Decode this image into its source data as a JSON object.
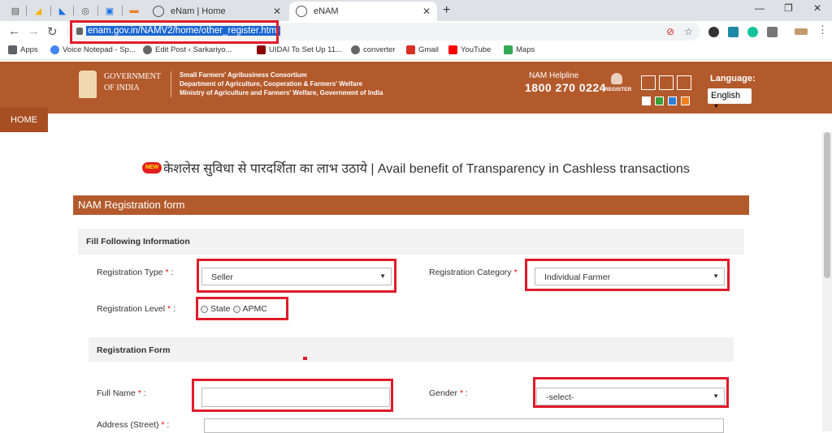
{
  "browser": {
    "tabs": [
      {
        "title": "eNam | Home",
        "active": false
      },
      {
        "title": "eNAM",
        "active": true
      }
    ],
    "url": "enam.gov.in/NAMV2/home/other_register.html",
    "bookmarks": [
      "Apps",
      "Voice Notepad - Sp...",
      "Edit Post ‹ Sarkariyo...",
      "UIDAI To Set Up 11...",
      "converter",
      "Gmail",
      "YouTube",
      "Maps"
    ],
    "new_tab_symbol": "+",
    "window_controls": [
      "—",
      "❐",
      "✕"
    ]
  },
  "header": {
    "gov_line1": "GOVERNMENT",
    "gov_line2": "OF INDIA",
    "org_line1": "Small Farmers' Agribusiness Consortium",
    "org_line2": "Department of Agriculture, Cooperation & Farmers' Welfare",
    "org_line3": "Ministry of Agriculture and Farmers' Welfare, Government of India",
    "helpline_label": "NAM Helpline",
    "helpline_number": "1800 270 0224",
    "register_label": "REGISTER",
    "language_label": "Language:",
    "language_value": "English",
    "theme_colors": [
      "#ffffff",
      "#3aa03a",
      "#2f7fd8",
      "#f08020"
    ]
  },
  "nav": {
    "home": "HOME"
  },
  "banner": {
    "badge": "NEW",
    "text": "केशलेस सुविधा से पारदर्शिता का लाभ उठाये | Avail benefit of Transparency in Cashless transactions"
  },
  "form": {
    "title": "NAM Registration form",
    "section1": "Fill Following Information",
    "registration_type_label": "Registration Type",
    "registration_type_value": "Seller",
    "registration_category_label": "Registration Category",
    "registration_category_value": "Individual Farmer",
    "registration_level_label": "Registration Level",
    "level_options": [
      "State",
      "APMC"
    ],
    "section2": "Registration Form",
    "full_name_label": "Full Name",
    "full_name_value": "",
    "gender_label": "Gender",
    "gender_value": "-select-",
    "address_label": "Address (Street)",
    "required_mark": "*",
    "colon": ":"
  }
}
